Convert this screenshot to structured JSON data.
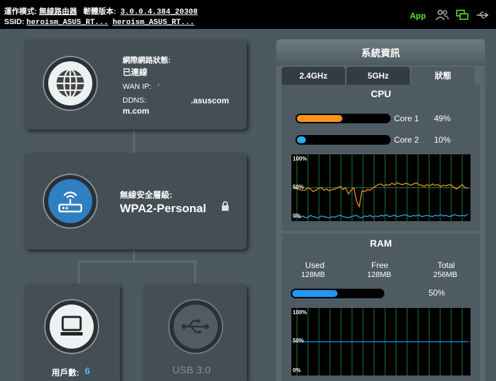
{
  "topbar": {
    "mode_label": "運作模式:",
    "mode_value": "無線路由器",
    "firmware_label": "韌體版本:",
    "firmware_value": "3.0.0.4.384_20308",
    "ssid_label": "SSID:",
    "ssid_1": "heroism_ASUS_RT...",
    "ssid_2": "heroism_ASUS_RT...",
    "app_label": "App"
  },
  "internet": {
    "status_label": "網際網路狀態:",
    "status_value": "已連線",
    "wan_ip_label": "WAN IP:",
    "wan_ip_value": "‘",
    "ddns_label": "DDNS:",
    "ddns_value_1": ".asuscom",
    "ddns_value_2": "m.com"
  },
  "wireless": {
    "security_label": "無線安全層級:",
    "security_value": "WPA2-Personal"
  },
  "clients": {
    "label": "用戶數:",
    "count": "6"
  },
  "usb": {
    "label": "USB 3.0"
  },
  "sysinfo": {
    "title": "系統資訊",
    "tabs": [
      "2.4GHz",
      "5GHz",
      "狀態"
    ],
    "active_tab": 2,
    "cpu": {
      "title": "CPU",
      "core1_label": "Core 1",
      "core1_value": "49%",
      "core1_fraction": 0.49,
      "core1_color": "#f7941d",
      "core2_label": "Core 2",
      "core2_value": "10%",
      "core2_fraction": 0.1,
      "core2_color": "#2dabe2",
      "axis": [
        "100%",
        "50%",
        "0%"
      ],
      "history_core1": [
        50,
        48,
        47,
        46,
        46,
        50,
        48,
        44,
        46,
        49,
        50,
        46,
        48,
        45,
        47,
        48,
        50,
        52,
        47,
        50,
        40,
        46,
        50,
        28,
        20,
        45,
        44,
        47,
        46,
        50,
        52,
        55,
        56,
        53,
        55,
        54,
        57,
        55,
        58,
        56,
        55,
        57,
        56,
        54,
        56,
        58,
        55,
        54,
        52,
        55,
        53,
        56,
        54,
        55,
        52,
        54,
        53,
        55,
        54,
        50,
        48,
        52,
        55,
        50,
        49
      ],
      "history_core2": [
        3,
        4,
        2,
        5,
        3,
        2,
        6,
        4,
        3,
        2,
        5,
        4,
        3,
        2,
        4,
        3,
        5,
        6,
        4,
        3,
        2,
        4,
        5,
        6,
        3,
        2,
        5,
        4,
        6,
        3,
        5,
        4,
        6,
        5,
        7,
        4,
        5,
        6,
        4,
        5,
        6,
        7,
        5,
        4,
        6,
        5,
        7,
        4,
        5,
        6,
        5,
        4,
        6,
        5,
        7,
        5,
        6,
        4,
        5,
        7,
        6,
        5,
        6,
        5,
        8
      ]
    },
    "ram": {
      "title": "RAM",
      "used_label": "Used",
      "used_value": "128MB",
      "free_label": "Free",
      "free_value": "128MB",
      "total_label": "Total",
      "total_value": "256MB",
      "percent": "50%",
      "fraction": 0.5,
      "color": "#2196f3",
      "axis": [
        "100%",
        "50%",
        "0%"
      ],
      "history": [
        50,
        50,
        50,
        50,
        50,
        50,
        50,
        50,
        50,
        50,
        50,
        50,
        50,
        50,
        50,
        50,
        50,
        50,
        50,
        50,
        50,
        50,
        50,
        50,
        50,
        50,
        50,
        50,
        50,
        50,
        50,
        50,
        50,
        50,
        50,
        50,
        50,
        50,
        50,
        50
      ]
    }
  },
  "colors": {
    "accent_green": "#5ee02f",
    "client_count_blue": "#52b4f2",
    "graph_grid": "#1e7d3a",
    "ram_line": "#2196f3"
  }
}
